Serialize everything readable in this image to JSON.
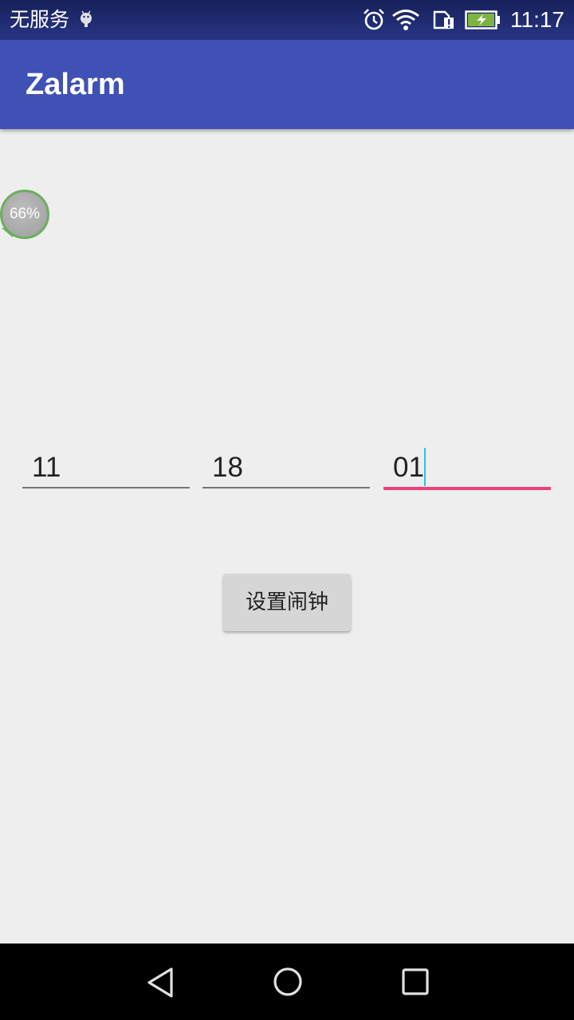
{
  "status_bar": {
    "carrier": "无服务",
    "time": "11:17",
    "icons": [
      "android-debug-icon",
      "alarm-icon",
      "wifi-icon",
      "sim-card-icon",
      "battery-charging-icon"
    ]
  },
  "app_bar": {
    "title": "Zalarm"
  },
  "battery_bubble": {
    "label": "66%",
    "percent": 66
  },
  "time_inputs": {
    "hour": "11",
    "minute": "18",
    "second": "01",
    "focused": "second"
  },
  "set_alarm_button": {
    "label": "设置闹钟"
  },
  "nav_bar": {
    "icons": [
      "back-icon",
      "home-icon",
      "recents-icon"
    ]
  },
  "colors": {
    "app_bar": "#3f51b5",
    "accent": "#ec407a",
    "background": "#eeeeee",
    "cursor": "#26c6da"
  }
}
